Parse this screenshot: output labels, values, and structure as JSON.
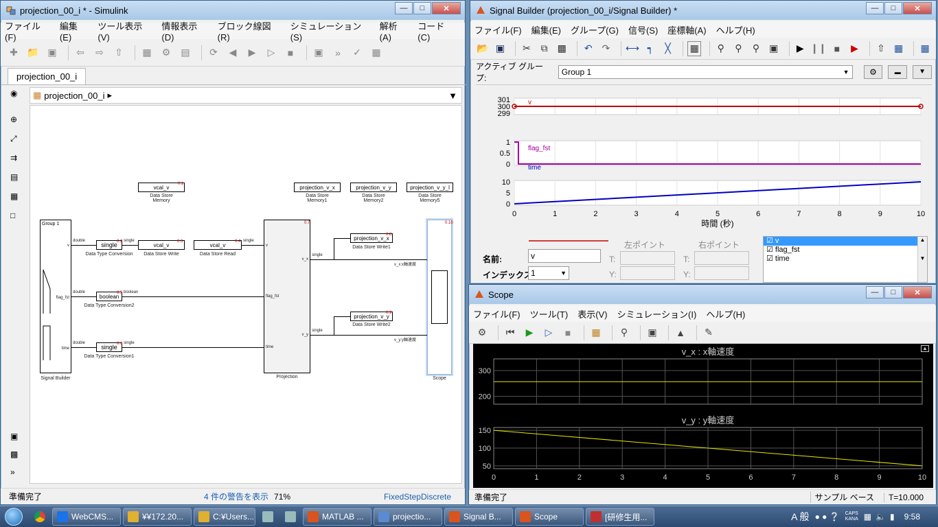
{
  "simulink": {
    "title": "projection_00_i * - Simulink",
    "menu": [
      "ファイル(F)",
      "編集(E)",
      "ツール表示(V)",
      "情報表示(D)",
      "ブロック線図(R)",
      "シミュレーション(S)",
      "解析(A)",
      "コード(C)"
    ],
    "tab": "projection_00_i",
    "breadcrumb": "projection_00_i",
    "status": {
      "ready": "準備完了",
      "warnings": "4 件の警告を表示",
      "zoom": "71%",
      "solver": "FixedStepDiscrete"
    },
    "blocks": {
      "signal_builder": {
        "group": "Group 1",
        "label": "Signal Builder",
        "ports": [
          "v",
          "flag_fst",
          "time"
        ]
      },
      "dtc": {
        "text": "single",
        "label": "Data Type Conversion"
      },
      "dtc2": {
        "text": "boolean",
        "label": "Data Type Conversion2"
      },
      "dtc1": {
        "text": "single",
        "label": "Data Type Conversion1"
      },
      "ds_write": {
        "text": "vcal_v",
        "label": "Data Store Write"
      },
      "ds_read": {
        "text": "vcal_v",
        "label": "Data Store Read"
      },
      "ds_mem": {
        "text": "vcal_v",
        "label": "Data Store Memory"
      },
      "ds_mem1": {
        "text": "projection_v_x",
        "label": "Data Store Memory1"
      },
      "ds_mem2": {
        "text": "projection_v_y",
        "label": "Data Store Memory2"
      },
      "ds_mem5": {
        "text": "projection_v_y_l",
        "label": "Data Store Memory5"
      },
      "ds_write1": {
        "text": "projection_v_x",
        "label": "Data Store Write1"
      },
      "ds_write2": {
        "text": "projection_v_y",
        "label": "Data Store Write2"
      },
      "projection": {
        "label": "Projection",
        "in": [
          "v",
          "flag_fst",
          "time"
        ],
        "out": [
          "v_x",
          "v_y"
        ]
      },
      "scope": {
        "label": "Scope"
      }
    },
    "signals": {
      "double": "double",
      "single": "single",
      "boolean": "boolean",
      "vx_name": "v_x:x軸速度",
      "vy_name": "v_y:y軸速度"
    },
    "tags": [
      "0.1",
      "0.2",
      "0.3",
      "0.4",
      "0.5",
      "0.6",
      "0.7",
      "0.8",
      "0.9",
      "0.10"
    ]
  },
  "signal_builder": {
    "title": "Signal Builder (projection_00_i/Signal Builder) *",
    "menu": [
      "ファイル(F)",
      "編集(E)",
      "グループ(G)",
      "信号(S)",
      "座標軸(A)",
      "ヘルプ(H)"
    ],
    "active_group_label": "アクティブ グループ:",
    "active_group": "Group 1",
    "xlabel": "時間 (秒)",
    "name_label": "名前:",
    "name_value": "v",
    "index_label": "インデックス:",
    "index_value": "1",
    "left_point": "左ポイント",
    "right_point": "右ポイント",
    "t_label": "T:",
    "y_label": "Y:",
    "signal_list": [
      "v",
      "flag_fst",
      "time"
    ],
    "colors": {
      "v": "#c00000",
      "flag_fst": "#a000a0",
      "time": "#0000c0"
    },
    "chart_data": [
      {
        "type": "line",
        "series": [
          {
            "name": "v",
            "x": [
              0,
              10
            ],
            "y": [
              300,
              300
            ]
          }
        ],
        "ylim": [
          299,
          301
        ],
        "yticks": [
          "301",
          "300",
          "299"
        ],
        "xlim": [
          0,
          10
        ]
      },
      {
        "type": "line",
        "series": [
          {
            "name": "flag_fst",
            "x": [
              0,
              0.1,
              0.1,
              10
            ],
            "y": [
              1,
              1,
              0,
              0
            ]
          }
        ],
        "ylim": [
          0,
          1
        ],
        "yticks": [
          "1",
          "0.5",
          "0"
        ],
        "xlim": [
          0,
          10
        ]
      },
      {
        "type": "line",
        "series": [
          {
            "name": "time",
            "x": [
              0,
              10
            ],
            "y": [
              0,
              10
            ]
          }
        ],
        "ylim": [
          0,
          10
        ],
        "yticks": [
          "10",
          "5",
          "0"
        ],
        "xlim": [
          0,
          10
        ],
        "xticks": [
          "0",
          "1",
          "2",
          "3",
          "4",
          "5",
          "6",
          "7",
          "8",
          "9",
          "10"
        ]
      }
    ]
  },
  "scope": {
    "title": "Scope",
    "menu": [
      "ファイル(F)",
      "ツール(T)",
      "表示(V)",
      "シミュレーション(I)",
      "ヘルプ(H)"
    ],
    "status": {
      "ready": "準備完了",
      "sample": "サンプル ベース",
      "time": "T=10.000"
    },
    "chart_data": [
      {
        "type": "line",
        "title": "v_x : x軸速度",
        "series": [
          {
            "name": "v_x",
            "x": [
              0,
              10
            ],
            "y": [
              257,
              257
            ]
          }
        ],
        "ylim": [
          170,
          345
        ],
        "yticks": [
          "300",
          "200"
        ],
        "xlim": [
          0,
          10
        ],
        "grid": true
      },
      {
        "type": "line",
        "title": "v_y : y軸速度",
        "series": [
          {
            "name": "v_y",
            "x": [
              0,
              10
            ],
            "y": [
              150,
              50
            ]
          }
        ],
        "ylim": [
          42,
          158
        ],
        "yticks": [
          "150",
          "100",
          "50"
        ],
        "xlim": [
          0,
          10
        ],
        "xticks": [
          "0",
          "1",
          "2",
          "3",
          "4",
          "5",
          "6",
          "7",
          "8",
          "9",
          "10"
        ],
        "grid": true
      }
    ],
    "line_color": "#e8e800"
  },
  "taskbar": {
    "items": [
      "WebCMS...",
      "¥¥172.20...",
      "C:¥Users...",
      "MATLAB ...",
      "projectio...",
      "Signal B...",
      "Scope",
      "[研修生用..."
    ],
    "tray": {
      "ime": "A 般",
      "caps": "CAPS",
      "kana": "KANA",
      "clock": "9:58"
    }
  }
}
